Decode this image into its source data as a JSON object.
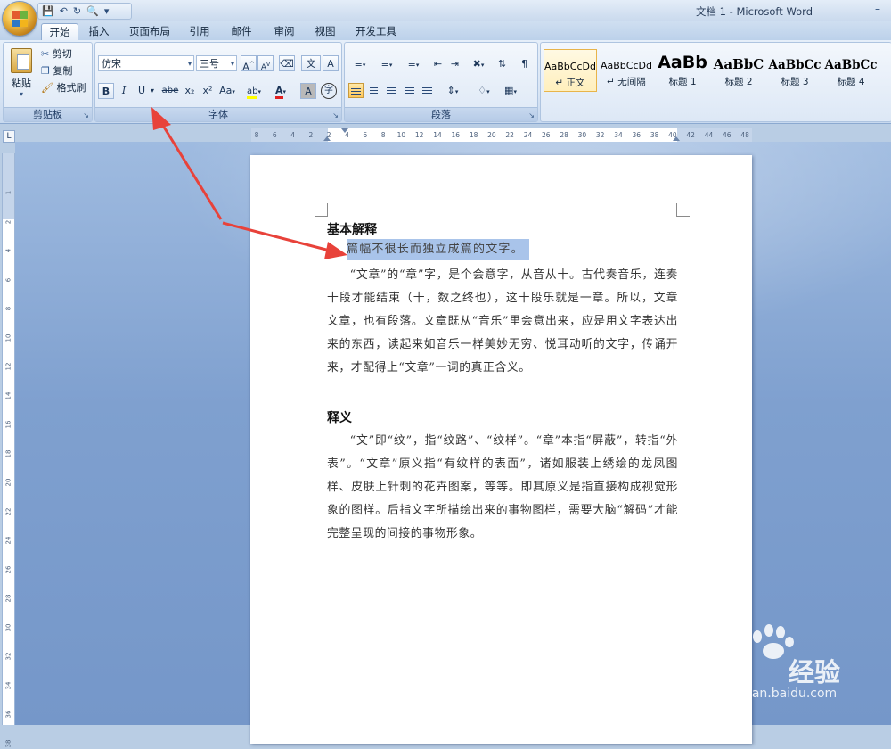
{
  "window": {
    "title": "文档 1 - Microsoft Word",
    "minimize_glyph": "–"
  },
  "qat": {
    "save_icon": "save-icon",
    "undo_icon": "undo-icon",
    "redo_icon": "redo-icon",
    "preview_icon": "print-preview-icon"
  },
  "tabs": [
    {
      "label": "开始",
      "active": true
    },
    {
      "label": "插入"
    },
    {
      "label": "页面布局"
    },
    {
      "label": "引用"
    },
    {
      "label": "邮件"
    },
    {
      "label": "审阅"
    },
    {
      "label": "视图"
    },
    {
      "label": "开发工具"
    }
  ],
  "clipboard": {
    "paste": "粘贴",
    "cut": "剪切",
    "copy": "复制",
    "format_painter": "格式刷",
    "label": "剪贴板"
  },
  "font": {
    "name": "仿宋",
    "size": "三号",
    "label": "字体",
    "grow": "A",
    "shrink": "A",
    "bold": "B",
    "italic": "I",
    "underline": "U",
    "strike": "abe",
    "subscript": "x₂",
    "superscript": "x²",
    "change_case": "Aa",
    "highlight": "ab",
    "font_color": "A",
    "char_shade": "A",
    "enclose": "字",
    "phonetic": "文"
  },
  "paragraph": {
    "label": "段落"
  },
  "styles": [
    {
      "sample": "AaBbCcDd",
      "name": "↵ 正文",
      "active": true
    },
    {
      "sample": "AaBbCcDd",
      "name": "↵ 无间隔"
    },
    {
      "sample": "AaBb",
      "name": "标题 1"
    },
    {
      "sample": "AaBbC",
      "name": "标题 2"
    },
    {
      "sample": "AaBbCc",
      "name": "标题 3"
    },
    {
      "sample": "AaBbCc",
      "name": "标题 4"
    }
  ],
  "ruler": {
    "corner": "L",
    "ticks": [
      "8",
      "6",
      "4",
      "2",
      "2",
      "4",
      "6",
      "8",
      "10",
      "12",
      "14",
      "16",
      "18",
      "20",
      "22",
      "24",
      "26",
      "28",
      "30",
      "32",
      "34",
      "36",
      "38",
      "40",
      "42",
      "44",
      "46",
      "48"
    ],
    "vticks": [
      "1",
      "2",
      "4",
      "6",
      "8",
      "10",
      "12",
      "14",
      "16",
      "18",
      "20",
      "22",
      "24",
      "26",
      "28",
      "30",
      "32",
      "34",
      "36",
      "38"
    ]
  },
  "document": {
    "heading1": "基本解释",
    "selected_line": "篇幅不很长而独立成篇的文字。",
    "para1": "“文章”的“章”字，是个会意字，从音从十。古代奏音乐，连奏十段才能结束（十，数之终也），这十段乐就是一章。所以，文章文章，也有段落。文章既从“音乐”里会意出来，应是用文字表达出来的东西，读起来如音乐一样美妙无穷、悦耳动听的文字，传诵开来，才配得上“文章”一词的真正含义。",
    "heading2": "释义",
    "para2": "“文”即“纹”，指“纹路”、“纹样”。“章”本指“屏蔽”，转指“外表”。“文章”原义指“有纹样的表面”，诸如服装上绣绘的龙凤图样、皮肤上针刺的花卉图案，等等。即其原义是指直接构成视觉形象的图样。后指文字所描绘出来的事物图样，需要大脑“解码”才能完整呈现的间接的事物形象。"
  },
  "watermark": {
    "brand": "Bai",
    "brand_tail": "经验",
    "url": "jingyan.baidu.com"
  },
  "colors": {
    "accent_red": "#e8423a",
    "selection": "#a9c4ea"
  }
}
